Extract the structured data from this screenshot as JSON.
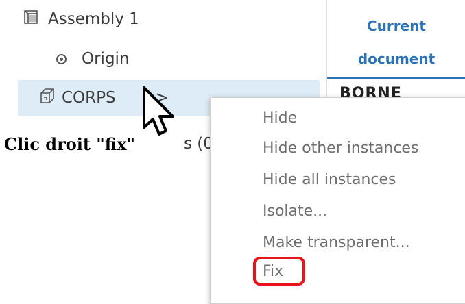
{
  "tree": {
    "assembly_label": "Assembly 1",
    "origin_label": "Origin",
    "part_label": "CORPS",
    "part_chevron": ">",
    "mates_partial": "s (0)"
  },
  "right_panel": {
    "tab_line1": "Current",
    "tab_line2": "document",
    "partial_heading": "BORNE"
  },
  "context_menu": {
    "items": [
      "Hide",
      "Hide other instances",
      "Hide all instances",
      "Isolate...",
      "Make transparent...",
      "Fix"
    ]
  },
  "annotation": {
    "text": "Clic droit \"fix\""
  },
  "colors": {
    "accent_blue": "#2b72b8",
    "selection_bg": "#deecf8",
    "highlight_red": "#e8131b",
    "menu_text": "#6e6e6e"
  }
}
